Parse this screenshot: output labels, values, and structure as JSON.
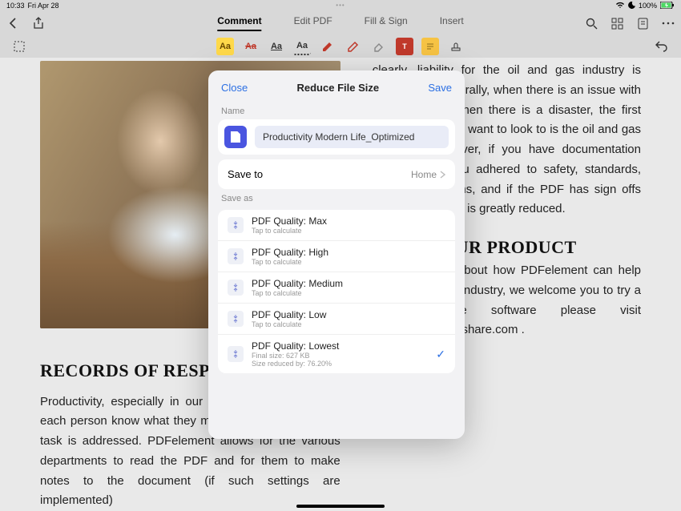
{
  "status": {
    "time": "10:33",
    "date": "Fri Apr 28",
    "battery": "100%"
  },
  "toolbar": {
    "tabs": [
      "Comment",
      "Edit PDF",
      "Fill & Sign",
      "Insert"
    ]
  },
  "document": {
    "left_heading": "RECORDS OF RESPONSIBILITY",
    "left_body": "Productivity, especially in our workforce, requires that each person know what they must do and to whom the task is addressed. PDFelement allows for the various departments to read the PDF and for them to make notes to the document (if such settings are implemented)",
    "right_body_1": "clearly, liability for the oil and gas industry is decreased. Generally, when there is an issue with operations, or when there is a disaster, the first place that people want to look to is the oil and gas company. However, if you have documentation showing that you adhered to safety, standards, and to regulations, and if the PDF has sign offs and such, liability is greatly reduced.",
    "right_heading": "ABOUT OUR PRODUCT",
    "right_body_2": "To know more about how PDFelement can help the Oil and Gas industry, we welcome you to try a trial of the software please visit http://pdf.wondershare.com ."
  },
  "modal": {
    "close": "Close",
    "title": "Reduce File Size",
    "save": "Save",
    "name_label": "Name",
    "filename": "Productivity Modern Life_Optimized",
    "saveto_label": "Save to",
    "saveto_value": "Home",
    "saveas_label": "Save as",
    "qualities": [
      {
        "title": "PDF Quality: Max",
        "sub": "Tap to calculate"
      },
      {
        "title": "PDF Quality: High",
        "sub": "Tap to calculate"
      },
      {
        "title": "PDF Quality: Medium",
        "sub": "Tap to calculate"
      },
      {
        "title": "PDF Quality: Low",
        "sub": "Tap to calculate"
      },
      {
        "title": "PDF Quality: Lowest",
        "sub": "Final size: 627 KB\nSize reduced by: 76.20%"
      }
    ],
    "selected_index": 4
  }
}
